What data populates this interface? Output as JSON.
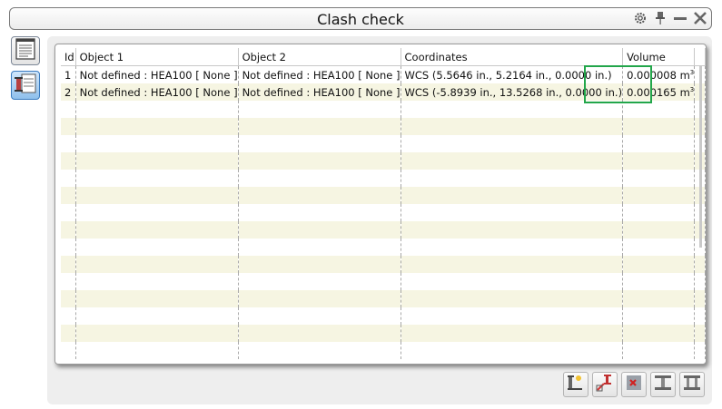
{
  "window": {
    "title": "Clash check"
  },
  "titlebar_icons": [
    "gear-icon",
    "pin-icon",
    "minimize-icon",
    "close-icon"
  ],
  "side_buttons": [
    {
      "name": "report-icon",
      "active": false
    },
    {
      "name": "clash-list-icon",
      "active": true
    }
  ],
  "table": {
    "columns": [
      "Id",
      "Object 1",
      "Object 2",
      "Coordinates",
      "Volume"
    ],
    "rows": [
      {
        "id": "1",
        "object1": "Not defined : HEA100 [ None ]",
        "object2": "Not defined : HEA100 [ None ]",
        "coordinates": "WCS (5.5646 in., 5.2164 in., 0.0000 in.)",
        "volume": "0.000008 m",
        "volume_unit_exp": "3"
      },
      {
        "id": "2",
        "object1": "Not defined : HEA100 [ None ]",
        "object2": "Not defined : HEA100 [ None ]",
        "coordinates": "WCS (-5.8939 in., 13.5268 in., 0.0000 in.)",
        "volume": "0.000165 m",
        "volume_unit_exp": "3"
      }
    ]
  },
  "highlight_color": "#22a64a",
  "bottom_buttons": [
    "select-objects-icon",
    "zoom-clash-icon",
    "ignore-clash-icon",
    "split-view-icon",
    "group-icon"
  ]
}
